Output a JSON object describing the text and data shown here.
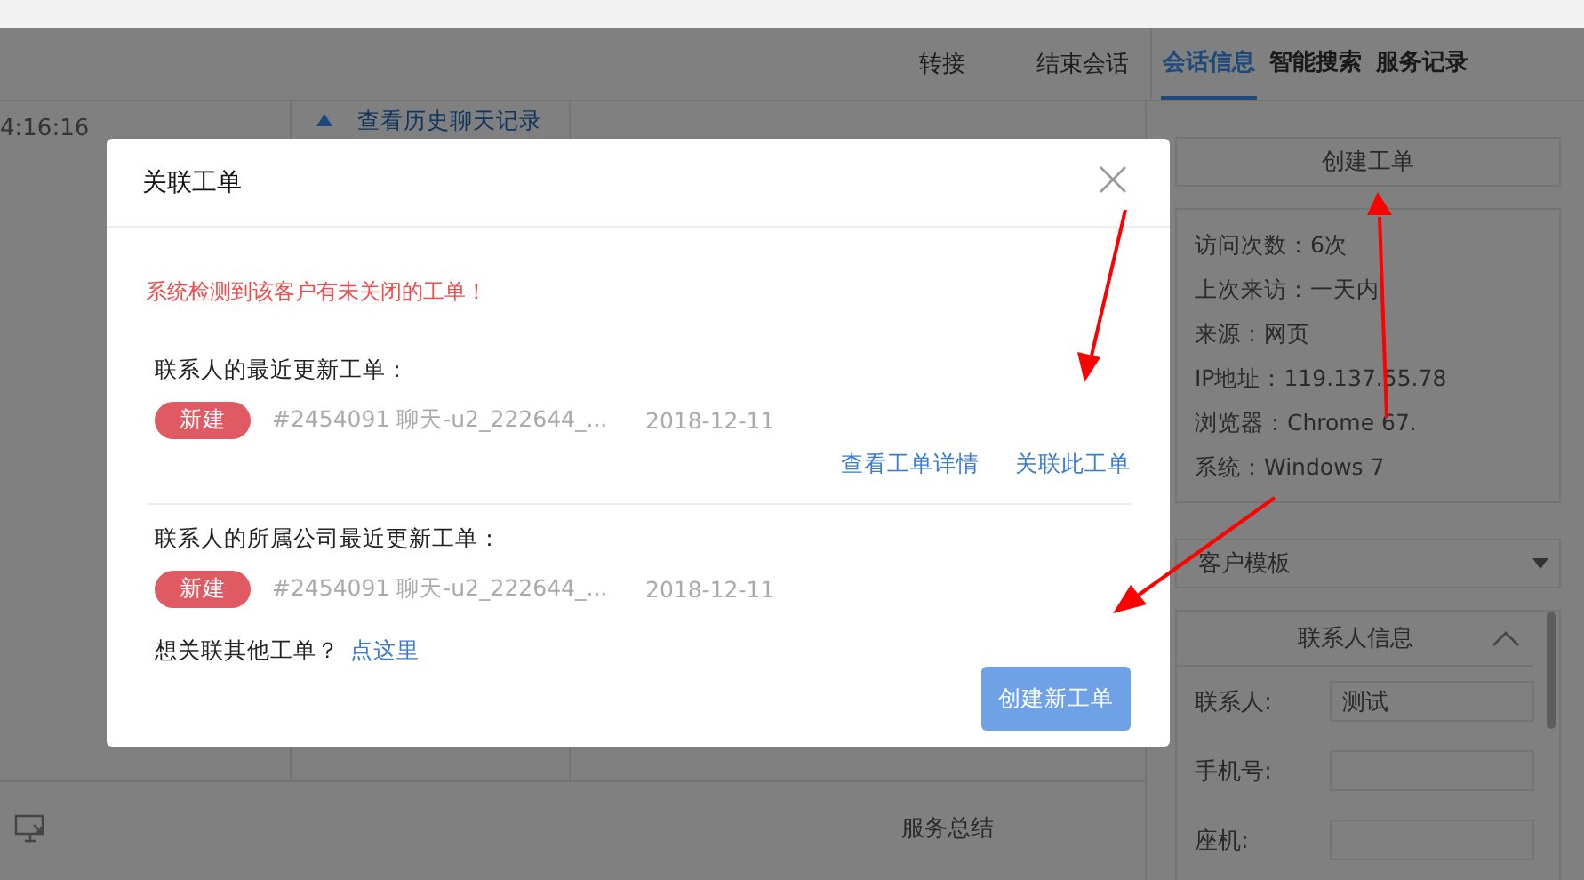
{
  "chat_actions": [
    "转接",
    "结束会话"
  ],
  "side_tabs": [
    {
      "label": "会话信息",
      "selected": true
    },
    {
      "label": "智能搜索",
      "selected": false
    },
    {
      "label": "服务记录",
      "selected": false
    }
  ],
  "chat": {
    "time": "4:16:16",
    "history_link": "查看历史聊天记录"
  },
  "bottom_bar": {
    "summary_tab": "服务总结"
  },
  "side_panel": {
    "create_button": "创建工单",
    "visitor_info": [
      "访问次数：6次",
      "上次来访：一天内",
      "来源：网页",
      "IP地址：119.137.55.78",
      "浏览器：Chrome 67.",
      "系统：Windows 7"
    ],
    "template_select": "客户模板",
    "contact_section": {
      "title": "联系人信息",
      "expanded": true,
      "fields": [
        {
          "label": "联系人:",
          "value": "测试"
        },
        {
          "label": "手机号:"
        },
        {
          "label": "座机:"
        }
      ]
    }
  },
  "dialog": {
    "title": "关联工单",
    "warning": "系统检测到该客户有未关闭的工单！",
    "sections": [
      {
        "heading": "联系人的最近更新工单：",
        "ticket": {
          "status": "新建",
          "title": "#2454091 聊天-u2_222644_...",
          "date": "2018-12-11"
        },
        "actions": [
          "查看工单详情",
          "关联此工单"
        ]
      },
      {
        "heading": "联系人的所属公司最近更新工单：",
        "ticket": {
          "status": "新建",
          "title": "#2454091 聊天-u2_222644_...",
          "date": "2018-12-11"
        }
      }
    ],
    "other_prompt": "想关联其他工单？",
    "other_link": "点这里",
    "create_button": "创建新工单"
  }
}
